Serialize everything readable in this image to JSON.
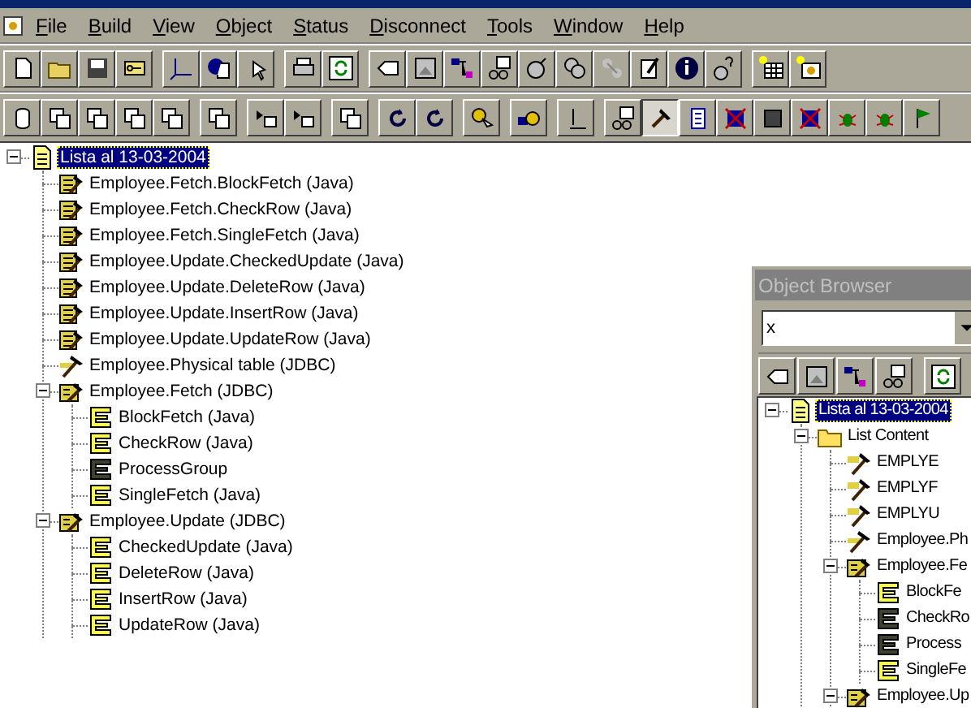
{
  "menu": [
    "File",
    "Build",
    "View",
    "Object",
    "Status",
    "Disconnect",
    "Tools",
    "Window",
    "Help"
  ],
  "toolbar_1": [
    [
      {
        "pressed": false
      },
      {
        "pressed": false
      },
      {
        "pressed": false
      },
      {
        "pressed": false
      }
    ],
    [
      {
        "pressed": false
      },
      {
        "pressed": false
      },
      {
        "pressed": false
      }
    ],
    [
      {
        "pressed": false
      },
      {
        "pressed": false
      }
    ],
    [
      {
        "pressed": false
      },
      {
        "pressed": false
      },
      {
        "pressed": false
      },
      {
        "pressed": false
      },
      {
        "pressed": false
      },
      {
        "pressed": false
      },
      {
        "pressed": false
      },
      {
        "pressed": false
      },
      {
        "pressed": false
      },
      {
        "pressed": false
      }
    ],
    [
      {
        "pressed": false
      },
      {
        "pressed": false
      }
    ]
  ],
  "toolbar_2": [
    [
      {
        "pressed": false
      },
      {
        "pressed": false
      },
      {
        "pressed": false
      },
      {
        "pressed": false
      },
      {
        "pressed": false
      }
    ],
    [
      {
        "pressed": false
      }
    ],
    [
      {
        "pressed": false
      },
      {
        "pressed": false
      }
    ],
    [
      {
        "pressed": false
      }
    ],
    [
      {
        "pressed": false
      },
      {
        "pressed": false
      }
    ],
    [
      {
        "pressed": false
      }
    ],
    [
      {
        "pressed": false
      }
    ],
    [
      {
        "pressed": false
      }
    ],
    [
      {
        "pressed": false
      },
      {
        "pressed": true
      },
      {
        "pressed": false
      },
      {
        "pressed": false
      },
      {
        "pressed": false
      },
      {
        "pressed": false
      },
      {
        "pressed": false
      },
      {
        "pressed": false
      },
      {
        "pressed": false
      }
    ]
  ],
  "tree": [
    {
      "label": "Lista al 13-03-2004",
      "kind": "list",
      "selected": true,
      "expanded": true,
      "children": [
        {
          "label": "Employee.Fetch.BlockFetch (Java)",
          "kind": "method",
          "selected": false
        },
        {
          "label": "Employee.Fetch.CheckRow (Java)",
          "kind": "method",
          "selected": false
        },
        {
          "label": "Employee.Fetch.SingleFetch (Java)",
          "kind": "method",
          "selected": false
        },
        {
          "label": "Employee.Update.CheckedUpdate (Java)",
          "kind": "method",
          "selected": false
        },
        {
          "label": "Employee.Update.DeleteRow (Java)",
          "kind": "method",
          "selected": false
        },
        {
          "label": "Employee.Update.InsertRow (Java)",
          "kind": "method",
          "selected": false
        },
        {
          "label": "Employee.Update.UpdateRow (Java)",
          "kind": "method",
          "selected": false
        },
        {
          "label": "Employee.Physical table (JDBC)",
          "kind": "table",
          "selected": false
        },
        {
          "label": "Employee.Fetch (JDBC)",
          "kind": "component",
          "selected": false,
          "expanded": true,
          "children": [
            {
              "label": "BlockFetch (Java)",
              "kind": "function",
              "selected": false
            },
            {
              "label": "CheckRow (Java)",
              "kind": "function",
              "selected": false
            },
            {
              "label": "ProcessGroup",
              "kind": "function_dark",
              "selected": false
            },
            {
              "label": "SingleFetch (Java)",
              "kind": "function",
              "selected": false
            }
          ]
        },
        {
          "label": "Employee.Update (JDBC)",
          "kind": "component",
          "selected": false,
          "expanded": true,
          "children": [
            {
              "label": "CheckedUpdate (Java)",
              "kind": "function",
              "selected": false
            },
            {
              "label": "DeleteRow (Java)",
              "kind": "function",
              "selected": false
            },
            {
              "label": "InsertRow (Java)",
              "kind": "function",
              "selected": false
            },
            {
              "label": "UpdateRow (Java)",
              "kind": "function",
              "selected": false
            }
          ]
        }
      ]
    }
  ],
  "object_browser": {
    "title": "Object Browser",
    "filter": "x",
    "toolbar": [
      {
        "pressed": false
      },
      {
        "pressed": false
      },
      {
        "pressed": false
      },
      {
        "pressed": false
      },
      {
        "pressed": false
      }
    ],
    "tree": [
      {
        "label": "Lista al 13-03-2004",
        "kind": "list",
        "selected": true,
        "expanded": true,
        "children": [
          {
            "label": "List Content",
            "kind": "folder",
            "selected": false,
            "expanded": true,
            "children": [
              {
                "label": "EMPLYE",
                "kind": "entity",
                "selected": false
              },
              {
                "label": "EMPLYF",
                "kind": "entity",
                "selected": false
              },
              {
                "label": "EMPLYU",
                "kind": "entity",
                "selected": false
              },
              {
                "label": "Employee.Ph",
                "kind": "table",
                "selected": false
              },
              {
                "label": "Employee.Fe",
                "kind": "component",
                "selected": false,
                "expanded": true,
                "children": [
                  {
                    "label": "BlockFe",
                    "kind": "function",
                    "selected": false
                  },
                  {
                    "label": "CheckRo",
                    "kind": "function_dark",
                    "selected": false
                  },
                  {
                    "label": "Process",
                    "kind": "function_dark",
                    "selected": false
                  },
                  {
                    "label": "SingleFe",
                    "kind": "function",
                    "selected": false
                  }
                ]
              },
              {
                "label": "Employee.Up",
                "kind": "component",
                "selected": false,
                "expanded": true
              }
            ]
          }
        ]
      }
    ]
  }
}
